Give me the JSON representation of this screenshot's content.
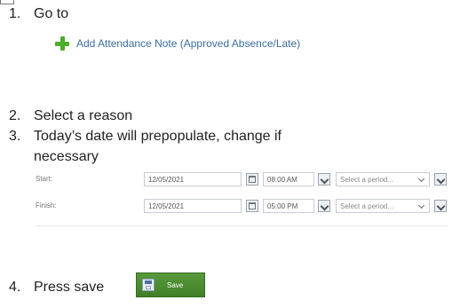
{
  "steps": [
    {
      "number": "1.",
      "text": "Go to"
    },
    {
      "number": "2.",
      "text": "Select a reason"
    },
    {
      "number": "3.",
      "text": "Today’s date will prepopulate, change if",
      "continuation": "necessary"
    },
    {
      "number": "4.",
      "text": "Press save"
    }
  ],
  "add_note_link": {
    "label": "Add Attendance Note (Approved Absence/Late)",
    "icon": "plus-icon",
    "icon_color": "#4caf2a"
  },
  "form": {
    "start": {
      "label": "Start:",
      "date": "12/05/2021",
      "time": "08:00 AM",
      "period_placeholder": "Select a period..."
    },
    "finish": {
      "label": "Finish:",
      "date": "12/05/2021",
      "time": "05:00 PM",
      "period_placeholder": "Select a period..."
    }
  },
  "save_button": {
    "label": "Save",
    "icon": "save-icon",
    "color": "#4a8a30"
  },
  "colors": {
    "link": "#3a6ea5",
    "text": "#222222"
  }
}
